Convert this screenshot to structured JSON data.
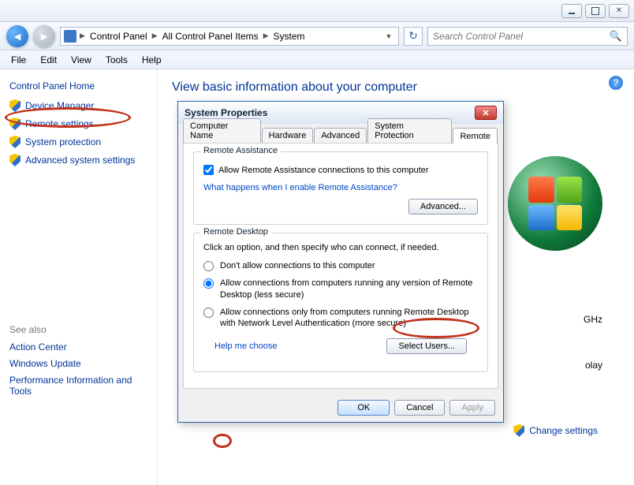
{
  "titlebar": {},
  "nav": {
    "breadcrumb": [
      "Control Panel",
      "All Control Panel Items",
      "System"
    ],
    "search_placeholder": "Search Control Panel"
  },
  "menu": {
    "items": [
      "File",
      "Edit",
      "View",
      "Tools",
      "Help"
    ]
  },
  "sidebar": {
    "home": "Control Panel Home",
    "links": [
      "Device Manager",
      "Remote settings",
      "System protection",
      "Advanced system settings"
    ],
    "see_also_header": "See also",
    "see_also": [
      "Action Center",
      "Windows Update",
      "Performance Information and Tools"
    ]
  },
  "content": {
    "heading": "View basic information about your computer",
    "ghz": "GHz",
    "olay": "olay",
    "change_settings": "Change settings"
  },
  "dialog": {
    "title": "System Properties",
    "tabs": [
      "Computer Name",
      "Hardware",
      "Advanced",
      "System Protection",
      "Remote"
    ],
    "active_tab": 4,
    "ra": {
      "legend": "Remote Assistance",
      "allow_checkbox": "Allow Remote Assistance connections to this computer",
      "help_link": "What happens when I enable Remote Assistance?",
      "advanced_btn": "Advanced..."
    },
    "rd": {
      "legend": "Remote Desktop",
      "instr": "Click an option, and then specify who can connect, if needed.",
      "opt1": "Don't allow connections to this computer",
      "opt2": "Allow connections from computers running any version of Remote Desktop (less secure)",
      "opt3": "Allow connections only from computers running Remote Desktop with Network Level Authentication (more secure)",
      "help_link": "Help me choose",
      "select_users_btn": "Select Users..."
    },
    "buttons": {
      "ok": "OK",
      "cancel": "Cancel",
      "apply": "Apply"
    }
  }
}
